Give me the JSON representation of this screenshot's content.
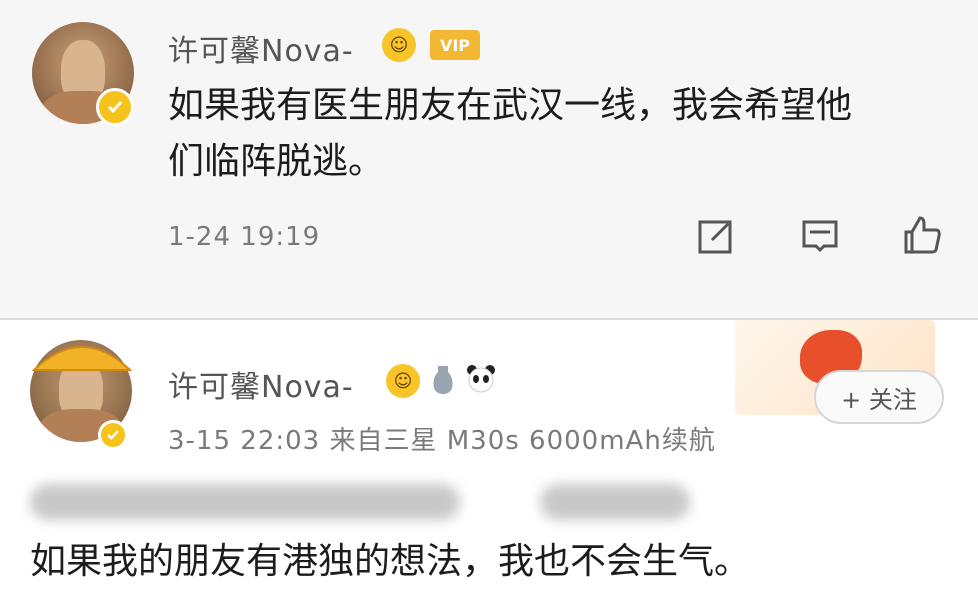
{
  "post1": {
    "username": "许可馨Nova-",
    "vip_label": "VIP",
    "text_line1": "如果我有医生朋友在武汉一线，我会希望他",
    "text_line2": "们临阵脱逃。",
    "timestamp": "1-24 19:19",
    "actions": [
      "repost-icon",
      "comment-icon",
      "like-icon"
    ]
  },
  "post2": {
    "username": "许可馨Nova-",
    "meta": "3-15 22:03  来自三星 M30s 6000mAh续航",
    "follow_label": "+ 关注",
    "text": "如果我的朋友有港独的想法，我也不会生气。"
  },
  "colors": {
    "badge": "#f6c21c",
    "post1_bg": "#f6f6f6",
    "text": "#1c1c1c",
    "meta": "#7a7a7a"
  }
}
